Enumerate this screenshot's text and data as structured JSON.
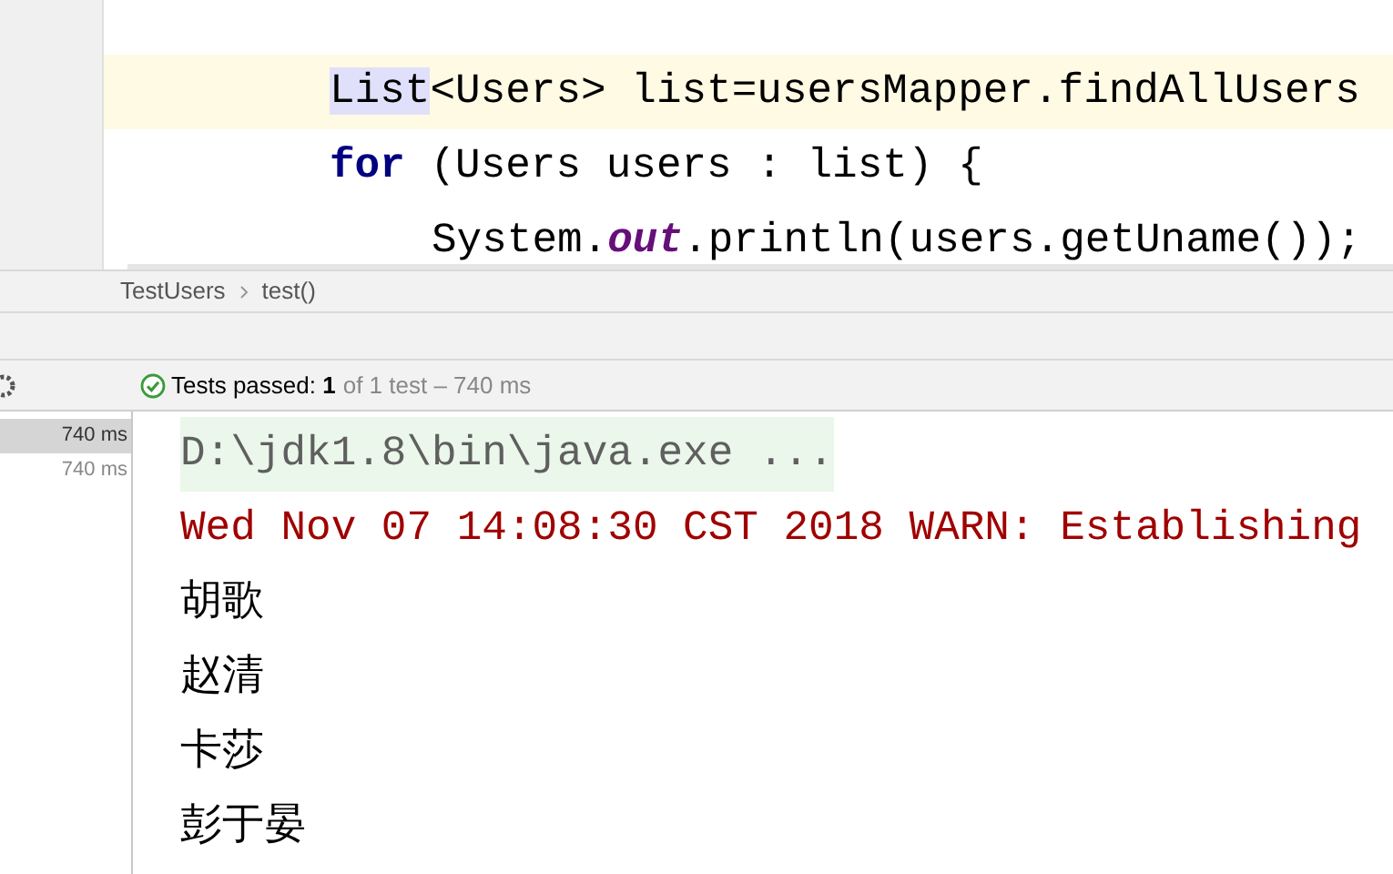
{
  "editor": {
    "lines": [
      {
        "current": true,
        "tokens": [
          {
            "text": "List",
            "kind": "highlighted"
          },
          {
            "text": "<Users> list=usersMapper.findAllUsers",
            "kind": "plain"
          }
        ]
      },
      {
        "current": false,
        "tokens": [
          {
            "text": "for",
            "kind": "keyword"
          },
          {
            "text": " (Users users : list) {",
            "kind": "plain"
          }
        ],
        "children": [
          {
            "current": false,
            "tokens": [
              {
                "text": "System.",
                "kind": "plain"
              },
              {
                "text": "out",
                "kind": "static_field"
              },
              {
                "text": ".println(users.getUname());",
                "kind": "plain"
              }
            ]
          }
        ]
      }
    ]
  },
  "breadcrumbs": [
    "TestUsers",
    "test()"
  ],
  "status": {
    "passed": "Tests passed: **1**",
    "detail": "of 1 test – 740 ms"
  },
  "test_tree": [
    {
      "label": "740 ms",
      "selected": true
    },
    {
      "label": "740 ms",
      "selected": false
    }
  ],
  "console": [
    {
      "kind": "command",
      "text": "D:\\jdk1.8\\bin\\java.exe ..."
    },
    {
      "kind": "error",
      "text": "Wed Nov 07 14:08:30 CST 2018 WARN: Establishing"
    },
    {
      "kind": "output",
      "text": "胡歌"
    },
    {
      "kind": "output",
      "text": "赵清"
    },
    {
      "kind": "output",
      "text": "卡莎"
    },
    {
      "kind": "output",
      "text": "彭于晏"
    }
  ]
}
